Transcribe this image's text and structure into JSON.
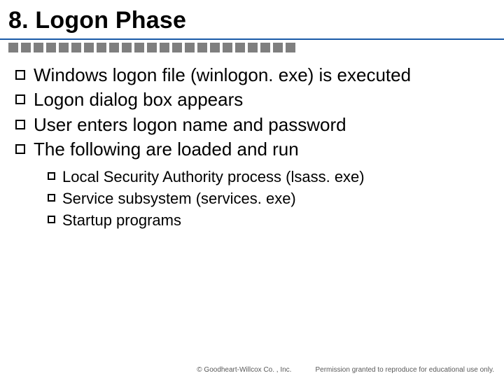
{
  "title": "8. Logon Phase",
  "bullets": {
    "main": [
      "Windows logon file (winlogon. exe) is executed",
      "Logon dialog box appears",
      "User enters logon name and password",
      "The following are loaded and run"
    ],
    "sub": [
      "Local Security Authority process (lsass. exe)",
      "Service subsystem (services. exe)",
      "Startup programs"
    ]
  },
  "footer": {
    "copyright": "© Goodheart-Willcox Co. , Inc.",
    "permission": "Permission granted to reproduce for educational use only."
  }
}
